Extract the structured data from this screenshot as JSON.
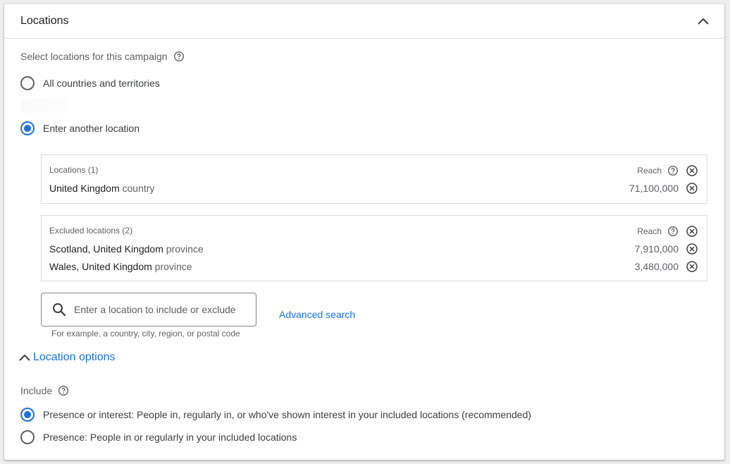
{
  "header": {
    "title": "Locations"
  },
  "select_label": "Select locations for this campaign",
  "radio_all": {
    "label": "All countries and territories",
    "selected": false
  },
  "radio_other": {
    "label": "Enter another location",
    "selected": true
  },
  "included": {
    "heading": "Locations (1)",
    "reach_label": "Reach",
    "rows": [
      {
        "name": "United Kingdom",
        "type": "country",
        "reach": "71,100,000"
      }
    ]
  },
  "excluded": {
    "heading": "Excluded locations (2)",
    "reach_label": "Reach",
    "rows": [
      {
        "name": "Scotland, United Kingdom",
        "type": "province",
        "reach": "7,910,000"
      },
      {
        "name": "Wales, United Kingdom",
        "type": "province",
        "reach": "3,480,000"
      }
    ]
  },
  "search": {
    "placeholder": "Enter a location to include or exclude",
    "value": "",
    "hint": "For example, a country, city, region, or postal code"
  },
  "advanced_search": "Advanced search",
  "location_options": "Location options",
  "include_label": "Include",
  "include_options": [
    {
      "label": "Presence or interest: People in, regularly in, or who've shown interest in your included locations (recommended)",
      "selected": true
    },
    {
      "label": "Presence: People in or regularly in your included locations",
      "selected": false
    }
  ],
  "colors": {
    "accent": "#1a73e8",
    "text": "#3c4043",
    "muted": "#5f6368",
    "border": "#dadce0"
  },
  "icons": [
    "chevron-up-icon",
    "help-icon",
    "close-circle-icon",
    "search-icon"
  ]
}
